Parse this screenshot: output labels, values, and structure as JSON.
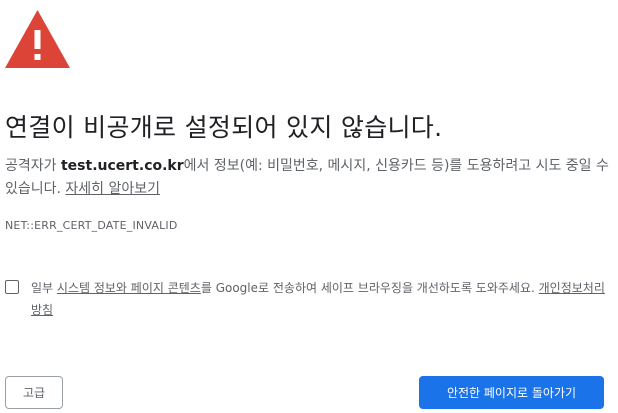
{
  "heading": "연결이 비공개로 설정되어 있지 않습니다.",
  "description": {
    "prefix": "공격자가 ",
    "host": "test.ucert.co.kr",
    "suffix": "에서 정보(예: 비밀번호, 메시지, 신용카드 등)를 도용하려고 시도 중일 수 있습니다. ",
    "learn_more": "자세히 알아보기"
  },
  "error_code": "NET::ERR_CERT_DATE_INVALID",
  "optin": {
    "prefix": "일부 ",
    "link_system_info": "시스템 정보와 페이지 콘텐츠",
    "middle": "를 Google로 전송하여 세이프 브라우징을 개선하도록 도와주세요. ",
    "link_privacy": "개인정보처리방침",
    "checked": false
  },
  "buttons": {
    "advanced": "고급",
    "back_to_safety": "안전한 페이지로 돌아가기"
  },
  "colors": {
    "warning": "#db4437",
    "primary": "#1a73e8",
    "text": "#202124",
    "secondary_text": "#5f6368"
  },
  "icons": {
    "warning": "warning-triangle-icon"
  }
}
